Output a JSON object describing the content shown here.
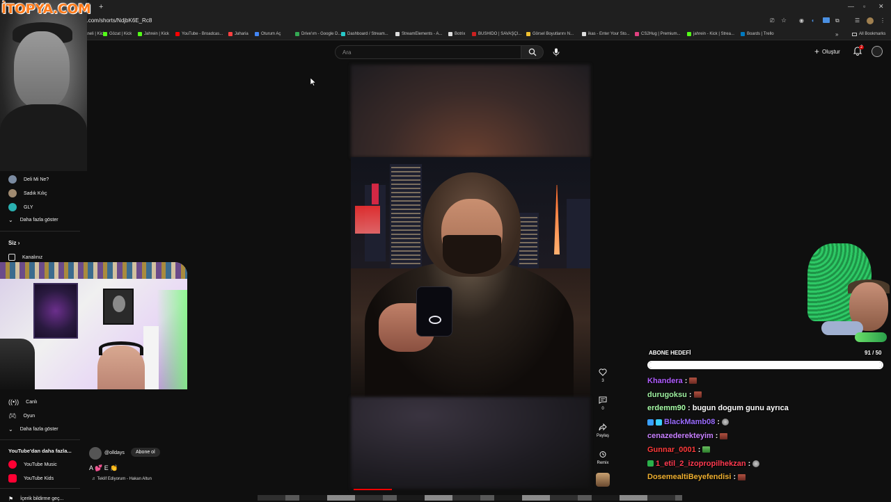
{
  "browser": {
    "url": "youtube.com/shorts/NdjbK6E_Rc8",
    "new_tab": "+",
    "bookmarks": [
      {
        "label": "...ıcı Paneli | Kick",
        "color": "#53fc18"
      },
      {
        "label": "Gözat | Kick",
        "color": "#53fc18"
      },
      {
        "label": "Jahrein | Kick",
        "color": "#53fc18"
      },
      {
        "label": "YouTube - Broadcas...",
        "color": "#ff0000"
      },
      {
        "label": "Jaharia",
        "color": "#ff4040"
      },
      {
        "label": "Oturum Aç",
        "color": "#4285f4"
      },
      {
        "label": "Drive'ım - Google D...",
        "color": "#34a853"
      },
      {
        "label": "Dashboard / Stream...",
        "color": "#28c8c8"
      },
      {
        "label": "StreamElements - A...",
        "color": "#dddddd"
      },
      {
        "label": "Botrix",
        "color": "#dddddd"
      },
      {
        "label": "BUSHIDO | SAVAŞÇI...",
        "color": "#cc2020"
      },
      {
        "label": "Görsel Boyutlarını N...",
        "color": "#f0c030"
      },
      {
        "label": "ikas - Enter Your Sto...",
        "color": "#dddddd"
      },
      {
        "label": "CS2Hug | Premium...",
        "color": "#e04080"
      },
      {
        "label": "jahrein - Kick | Strea...",
        "color": "#53fc18"
      },
      {
        "label": "Boards | Trello",
        "color": "#0079bf"
      }
    ],
    "all_bookmarks": "All Bookmarks",
    "chevron": "»"
  },
  "overlay_logo": "İTOPYA.COM",
  "header": {
    "search_placeholder": "Ara",
    "create_label": "Oluştur",
    "notif_count": "2"
  },
  "sidebar": {
    "subscriptions": [
      {
        "label": "Deli Mi Ne?",
        "color": "#7a8aa0"
      },
      {
        "label": "Sadık Kılıç",
        "color": "#a08a70"
      },
      {
        "label": "GLY",
        "color": "#2ab0b0"
      }
    ],
    "show_more_1": "Daha fazla göster",
    "you_title": "Siz",
    "channel_label": "Kanalınız",
    "explore": [
      {
        "label": "Canlı"
      },
      {
        "label": "Oyun"
      }
    ],
    "show_more_2": "Daha fazla göster",
    "more_from_title": "YouTube'dan daha fazla...",
    "more_from": [
      {
        "label": "YouTube Music"
      },
      {
        "label": "YouTube Kids"
      }
    ],
    "content_notifications": "İçerik bildirme geç..."
  },
  "short": {
    "channel": "@olldays",
    "subscribe_label": "Abone ol",
    "description": "A 💕 E 👏",
    "music": "♬ Teklif Ediyorum - Hakan Altun",
    "like_count": "3",
    "comment_count": "0",
    "share_label": "Paylaş",
    "remix_label": "Remix",
    "progress": 0.16
  },
  "subscriber_goal": {
    "label": "ABONE HEDEFİ",
    "count": "91 / 50",
    "current": 91,
    "target": 50
  },
  "chat": [
    {
      "user": "Khandera",
      "color": "#b05cff",
      "text": "",
      "emoji": "block",
      "badges": []
    },
    {
      "user": "durugoksu",
      "color": "#9ef0a0",
      "text": "",
      "emoji": "block",
      "badges": []
    },
    {
      "user": "erdemm90",
      "color": "#a8ffa8",
      "text": "bugun dogum gunu ayrıca",
      "emoji": "",
      "badges": []
    },
    {
      "user": "BlackMamb08",
      "color": "#9a6cff",
      "text": "",
      "emoji": "cat",
      "badges": [
        "#3aa0ff",
        "#3ad0ff"
      ]
    },
    {
      "user": "cenazederekteyim",
      "color": "#c880ff",
      "text": "",
      "emoji": "block",
      "badges": []
    },
    {
      "user": "Gunnar_0001",
      "color": "#ff3a3a",
      "text": "",
      "emoji": "green",
      "badges": []
    },
    {
      "user": "1_etil_2_izopropilhekzan",
      "color": "#ff3a50",
      "text": "",
      "emoji": "cat",
      "badges": [
        "#2ab04a"
      ]
    },
    {
      "user": "DosemealtiBeyefendisi",
      "color": "#f0b030",
      "text": "",
      "emoji": "block",
      "badges": []
    }
  ]
}
